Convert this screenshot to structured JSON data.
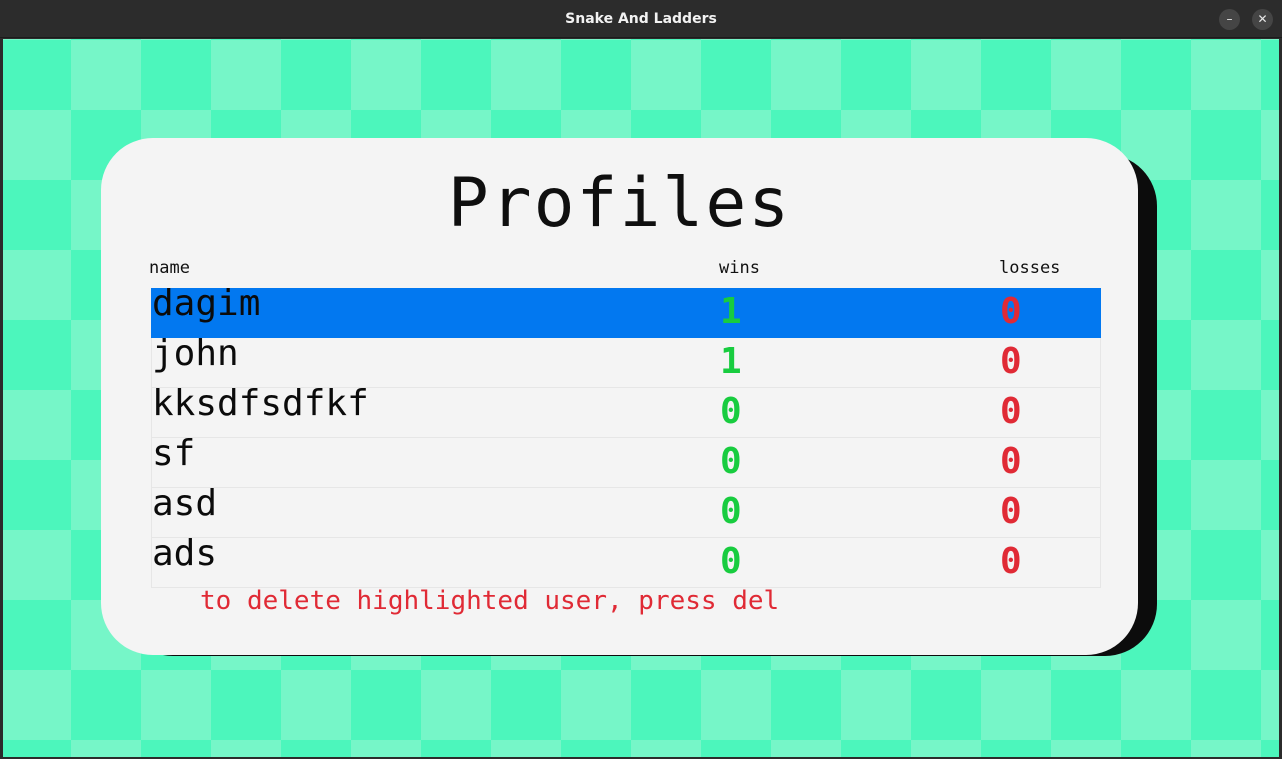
{
  "window": {
    "title": "Snake And Ladders",
    "minimize_glyph": "–",
    "close_glyph": "✕"
  },
  "screen": {
    "heading": "Profiles",
    "columns": {
      "name": "name",
      "wins": "wins",
      "losses": "losses"
    },
    "rows": [
      {
        "name": "dagim",
        "wins": "1",
        "losses": "0",
        "selected": true
      },
      {
        "name": "john",
        "wins": "1",
        "losses": "0",
        "selected": false
      },
      {
        "name": "kksdfsdfkf",
        "wins": "0",
        "losses": "0",
        "selected": false
      },
      {
        "name": "sf",
        "wins": "0",
        "losses": "0",
        "selected": false
      },
      {
        "name": "asd",
        "wins": "0",
        "losses": "0",
        "selected": false
      },
      {
        "name": "ads",
        "wins": "0",
        "losses": "0",
        "selected": false
      }
    ],
    "hint": "to delete highlighted user, press del"
  },
  "colors": {
    "checker_light": "#76f6c8",
    "checker_dark": "#4cf6bc",
    "selection": "#0278f0",
    "wins": "#18cc3f",
    "losses": "#e02a35"
  }
}
